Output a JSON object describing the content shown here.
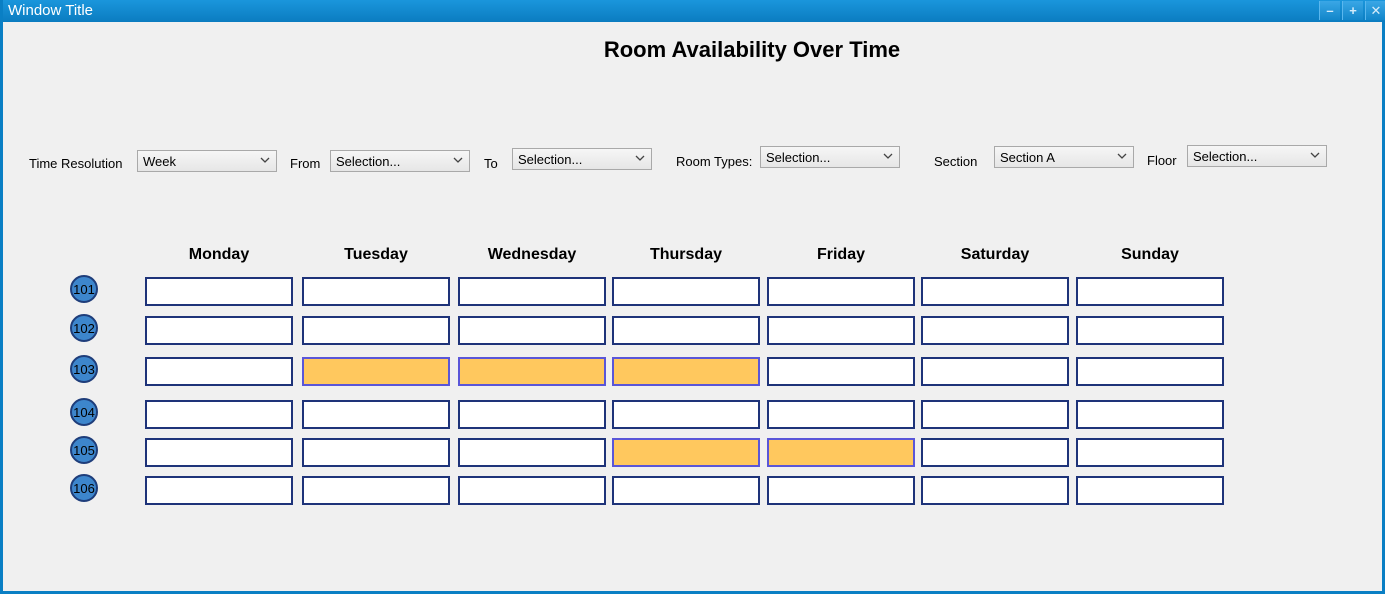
{
  "window": {
    "title": "Window Title",
    "minimize_glyph": "–",
    "maximize_glyph": "+",
    "close_glyph": "✕"
  },
  "page_title": "Room Availability Over Time",
  "filters": {
    "time_resolution": {
      "label": "Time Resolution",
      "value": "Week"
    },
    "from": {
      "label": "From",
      "value": "Selection..."
    },
    "to": {
      "label": "To",
      "value": "Selection..."
    },
    "room_types": {
      "label": "Room Types:",
      "value": "Selection..."
    },
    "section": {
      "label": "Section",
      "value": "Section A"
    },
    "floor": {
      "label": "Floor",
      "value": "Selection..."
    }
  },
  "days": [
    "Monday",
    "Tuesday",
    "Wednesday",
    "Thursday",
    "Friday",
    "Saturday",
    "Sunday"
  ],
  "rooms": [
    {
      "label": "101",
      "booked": [
        false,
        false,
        false,
        false,
        false,
        false,
        false
      ]
    },
    {
      "label": "102",
      "booked": [
        false,
        false,
        false,
        false,
        false,
        false,
        false
      ]
    },
    {
      "label": "103",
      "booked": [
        false,
        true,
        true,
        true,
        false,
        false,
        false
      ]
    },
    {
      "label": "104",
      "booked": [
        false,
        false,
        false,
        false,
        false,
        false,
        false
      ]
    },
    {
      "label": "105",
      "booked": [
        false,
        false,
        false,
        true,
        true,
        false,
        false
      ]
    },
    {
      "label": "106",
      "booked": [
        false,
        false,
        false,
        false,
        false,
        false,
        false
      ]
    }
  ],
  "colors": {
    "booked": "#ffc85e",
    "free": "#ffffff",
    "room_badge": "#3d86cc",
    "titlebar": "#0a7fc4"
  }
}
